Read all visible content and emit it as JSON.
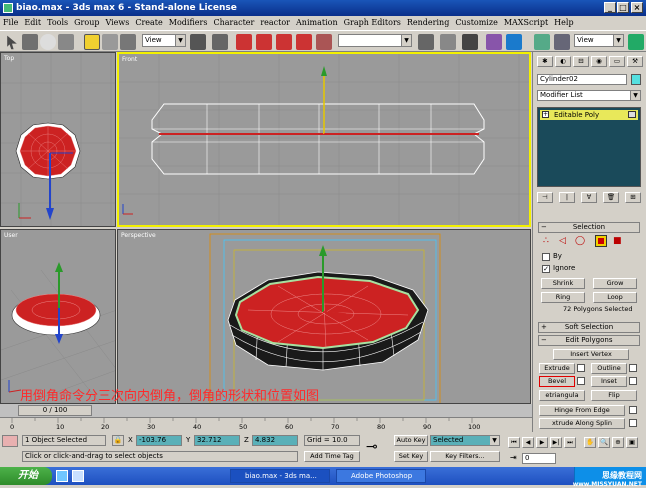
{
  "window": {
    "title": "biao.max - 3ds max 6 - Stand-alone License"
  },
  "menu": [
    "File",
    "Edit",
    "Tools",
    "Group",
    "Views",
    "Create",
    "Modifiers",
    "Character",
    "reactor",
    "Animation",
    "Graph Editors",
    "Rendering",
    "Customize",
    "MAXScript",
    "Help"
  ],
  "toolbar": {
    "view_dropdown": "View",
    "view_dropdown2": "View"
  },
  "viewports": {
    "top": "Top",
    "front": "Front",
    "user": "User",
    "perspective": "Perspective"
  },
  "command_panel": {
    "object_name": "Cylinder02",
    "modifier_list": "Modifier List",
    "stack_item": "Editable Poly",
    "selection_title": "Selection",
    "by_label": "By",
    "ignore_label": "Ignore",
    "shrink": "Shrink",
    "grow": "Grow",
    "ring": "Ring",
    "loop": "Loop",
    "polys_selected": "72 Polygons Selected",
    "soft_selection": "Soft Selection",
    "edit_polygons": "Edit Polygons",
    "insert_vertex": "Insert Vertex",
    "extrude": "Extrude",
    "outline": "Outline",
    "bevel": "Bevel",
    "inset": "Inset",
    "retriangulate": "etriangula",
    "flip": "Flip",
    "hinge": "Hinge From Edge",
    "extrude_spline": "xtrude Along Splin",
    "colors": {
      "object_color": "#55e0e0",
      "selected_poly": "#cc2222"
    }
  },
  "timeline": {
    "frame_label": "0 / 100",
    "ticks": [
      "0",
      "10",
      "20",
      "30",
      "40",
      "50",
      "60",
      "70",
      "80",
      "90",
      "100"
    ]
  },
  "status": {
    "objects_selected": "1 Object Selected",
    "prompt": "Click or click-and-drag to select objects",
    "x_label": "X",
    "x_value": "-103.76",
    "y_label": "Y",
    "y_value": "32.712",
    "z_label": "Z",
    "z_value": "4.832",
    "grid": "Grid = 10.0",
    "add_time_tag": "Add Time Tag",
    "auto_key": "Auto Key",
    "set_key": "Set Key",
    "key_filter_value": "Selected",
    "key_filters": "Key Filters...",
    "frame_field": "0"
  },
  "caption": "用倒角命令分三次向内倒角，倒角的形状和位置如图",
  "taskbar": {
    "start": "开始",
    "task1": "biao.max - 3ds ma...",
    "task2": "Adobe Photoshop"
  },
  "watermark": {
    "line1": "思缘教程网",
    "line2": "www.MISSYUAN.NET"
  }
}
